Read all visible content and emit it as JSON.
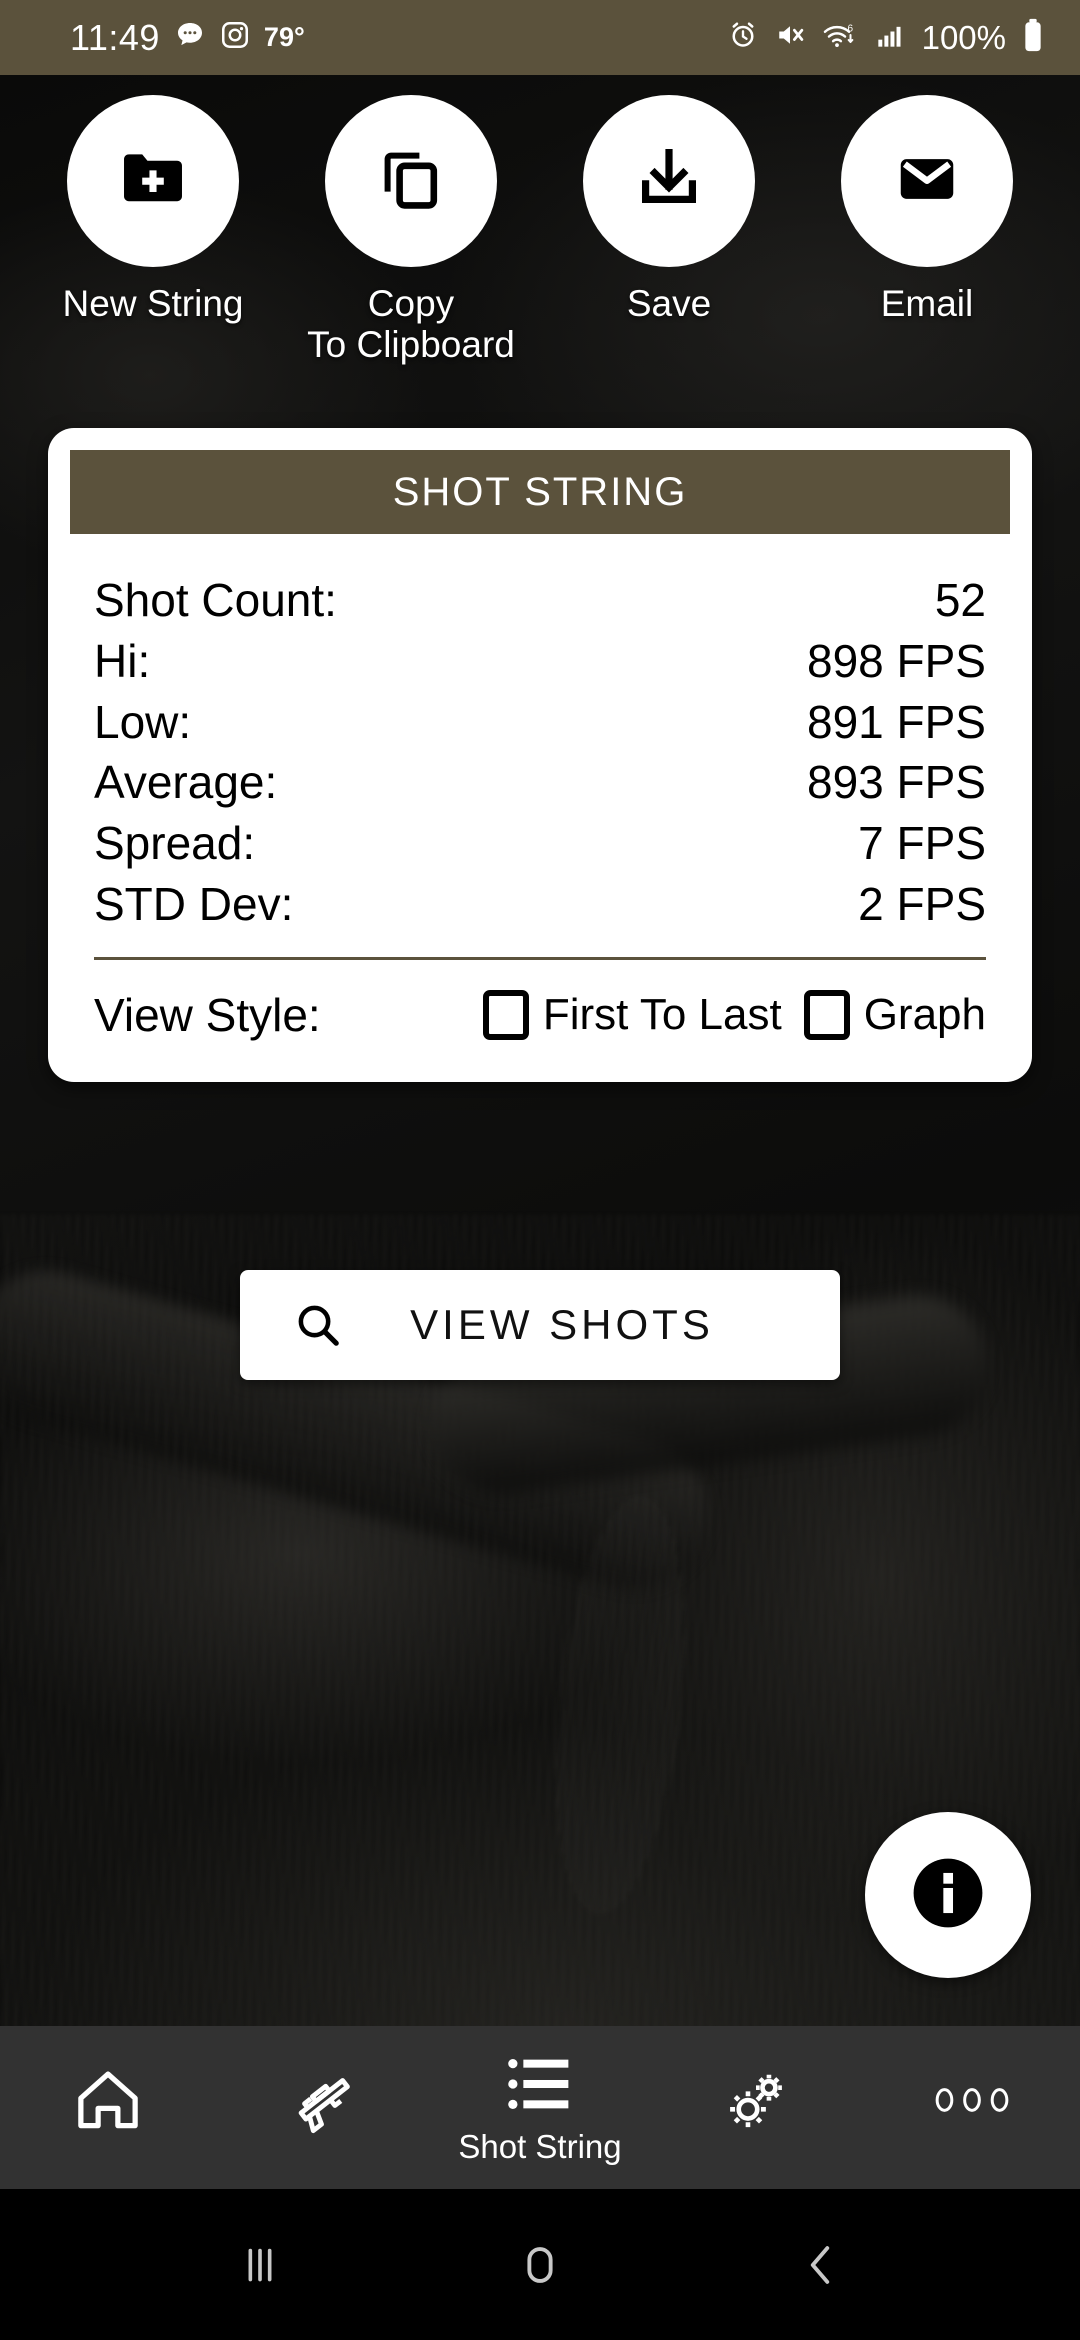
{
  "status_bar": {
    "time": "11:49",
    "temperature": "79°",
    "battery_percent": "100%",
    "icons": [
      "chat-bubble-icon",
      "instagram-icon",
      "alarm-icon",
      "mute-icon",
      "wifi-6-icon",
      "cellular-signal-icon",
      "battery-icon"
    ],
    "background_color": "#5B523C"
  },
  "actions": [
    {
      "label": "New String",
      "icon": "folder-plus-icon"
    },
    {
      "label": "Copy\nTo Clipboard",
      "label_line1": "Copy",
      "label_line2": "To Clipboard",
      "icon": "copy-icon"
    },
    {
      "label": "Save",
      "icon": "download-save-icon"
    },
    {
      "label": "Email",
      "icon": "envelope-icon"
    }
  ],
  "card": {
    "header_title": "SHOT STRING",
    "header_color": "#5B523C",
    "stats": [
      {
        "label": "Shot Count:",
        "value": "52"
      },
      {
        "label": "Hi:",
        "value": "898 FPS"
      },
      {
        "label": "Low:",
        "value": "891 FPS"
      },
      {
        "label": "Average:",
        "value": "893 FPS"
      },
      {
        "label": "Spread:",
        "value": "7 FPS"
      },
      {
        "label": "STD Dev:",
        "value": "2 FPS"
      }
    ],
    "view_style": {
      "label": "View Style:",
      "options": [
        {
          "label": "First To Last",
          "checked": false
        },
        {
          "label": "Graph",
          "checked": false
        }
      ]
    }
  },
  "view_shots_button": {
    "label": "VIEW SHOTS",
    "icon": "search-icon"
  },
  "info_fab": {
    "icon": "info-icon"
  },
  "bottom_nav": {
    "background_color": "#323232",
    "items": [
      {
        "label": "",
        "icon": "home-icon",
        "active": false
      },
      {
        "label": "",
        "icon": "rifle-icon",
        "active": false
      },
      {
        "label": "Shot String",
        "icon": "list-icon",
        "active": true
      },
      {
        "label": "",
        "icon": "gears-icon",
        "active": false
      },
      {
        "label": "",
        "icon": "more-dots-icon",
        "active": false
      }
    ]
  },
  "system_nav": {
    "items": [
      {
        "icon": "recents-icon"
      },
      {
        "icon": "home-button-icon"
      },
      {
        "icon": "back-icon"
      }
    ]
  }
}
